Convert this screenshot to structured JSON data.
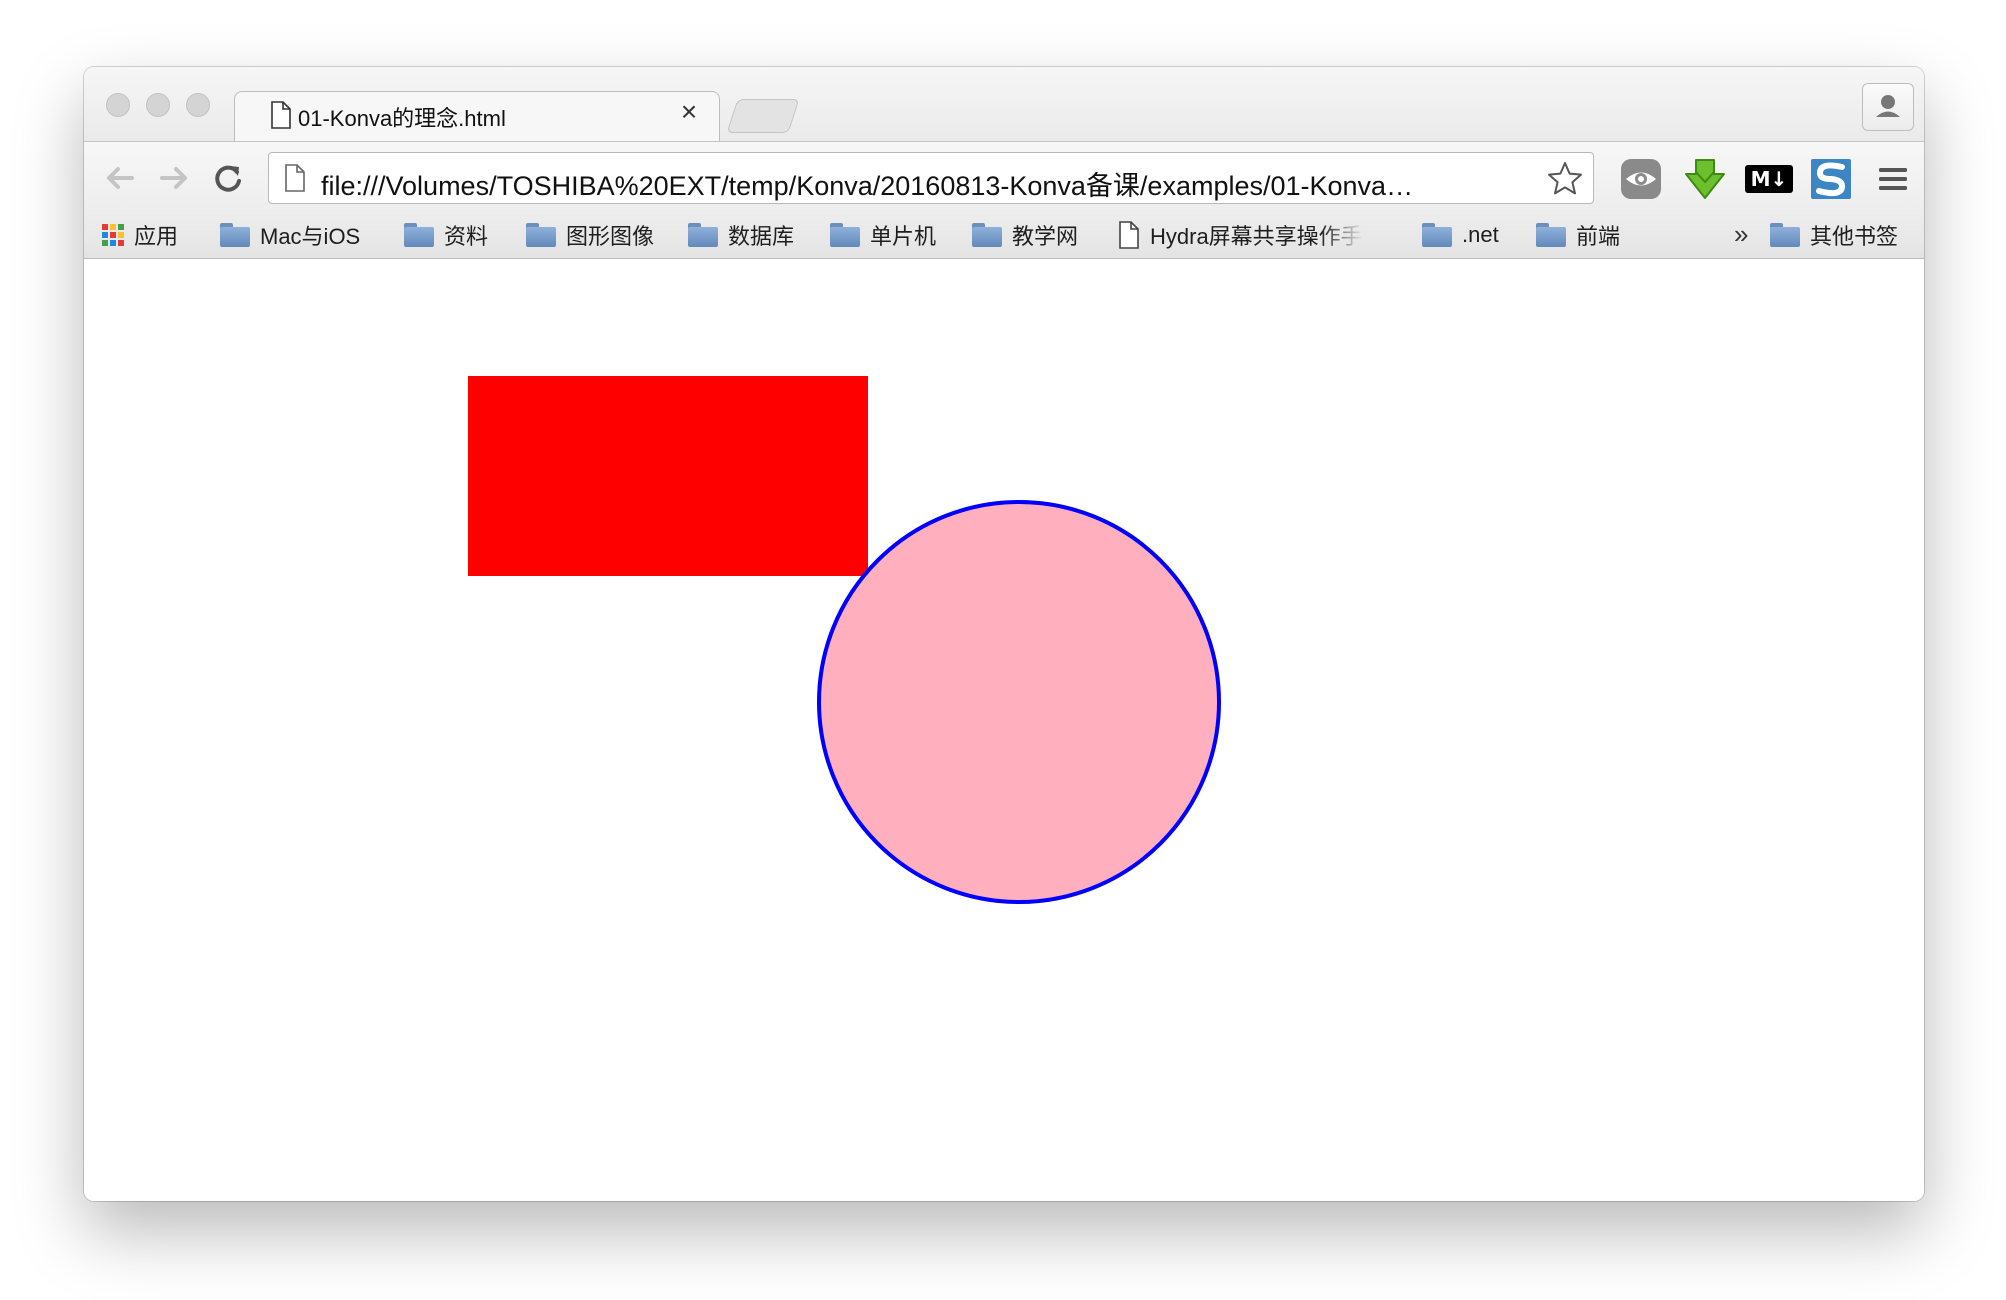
{
  "tab": {
    "title": "01-Konva的理念.html",
    "close_symbol": "×"
  },
  "address_bar": {
    "url": "file:///Volumes/TOSHIBA%20EXT/temp/Konva/20160813-Konva备课/examples/01-Konva…"
  },
  "extensions": {
    "markdown_label": "M↓",
    "markdown_label_parts": [
      "M",
      "↓"
    ]
  },
  "bookmarks": {
    "apps_label": "应用",
    "items": [
      {
        "label": "Mac与iOS",
        "type": "folder"
      },
      {
        "label": "资料",
        "type": "folder"
      },
      {
        "label": "图形图像",
        "type": "folder"
      },
      {
        "label": "数据库",
        "type": "folder"
      },
      {
        "label": "单片机",
        "type": "folder"
      },
      {
        "label": "教学网",
        "type": "folder"
      },
      {
        "label": "Hydra屏幕共享操作手",
        "type": "page"
      },
      {
        "label": ".net",
        "type": "folder"
      },
      {
        "label": "前端",
        "type": "folder"
      }
    ],
    "overflow_symbol": "»",
    "other_label": "其他书签"
  },
  "icons": {
    "nav": [
      "back-arrow-icon",
      "forward-arrow-icon",
      "reload-icon"
    ],
    "extensions": [
      "eye-extension-icon",
      "download-arrow-icon",
      "markdown-icon",
      "s-extension-icon",
      "menu-icon"
    ]
  },
  "canvas": {
    "shapes": [
      {
        "type": "rect",
        "fill": "#ff0000"
      },
      {
        "type": "circle",
        "fill": "#ffafbd",
        "stroke": "#0000ff"
      }
    ]
  },
  "colors": {
    "apps_grid": [
      "#e53935",
      "#fbc02d",
      "#43a047",
      "#1e88e5",
      "#e53935",
      "#fbc02d",
      "#43a047",
      "#1e88e5",
      "#e53935"
    ]
  }
}
